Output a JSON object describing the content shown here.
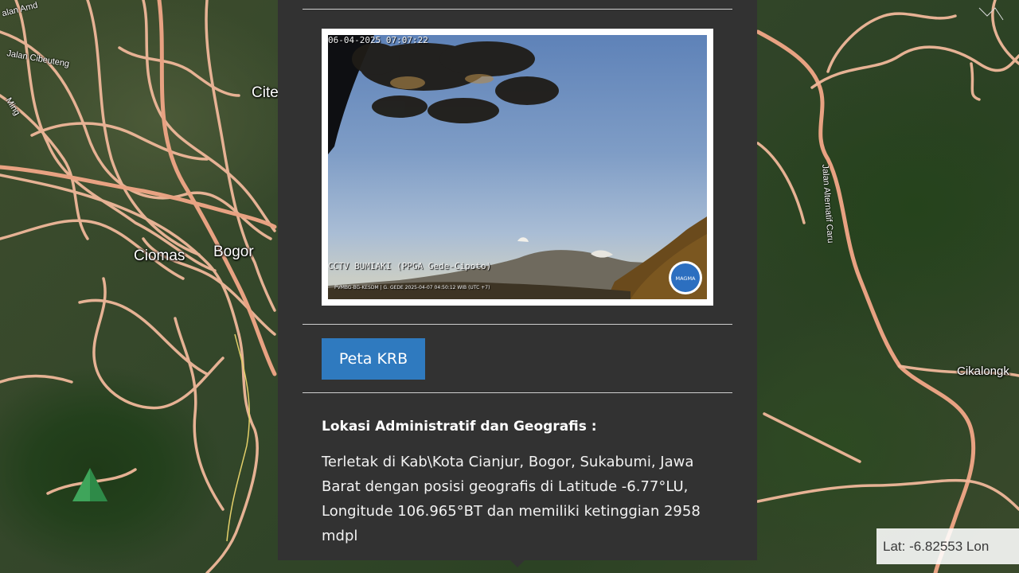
{
  "map": {
    "place_labels": {
      "ciomas": "Ciomas",
      "bogor": "Bogor",
      "cite": "Cite",
      "cikalong": "Cikalongk"
    },
    "road_labels": {
      "jalan_amd": "alan Amd",
      "jalan_cibeuteung": "Jalan Cibeuteng",
      "ming": "Ming",
      "jalan_aliexpresss": "Jalan Alternatif Caru"
    },
    "coordinates_readout": "Lat: -6.82553 Lon",
    "marker_icon": "green-triangle-volcano-icon",
    "colors": {
      "road": "#f0b89a",
      "road_major": "#e8a282"
    }
  },
  "popup": {
    "cctv": {
      "timestamp": "06-04-2025 07:07:22",
      "caption": "CCTV BUMIAKI (PPGA Gede-Cipoto)",
      "footer": "PVMBG-BG-KESDM | G. GEDE 2025-04-07 04:50:12 WIB (UTC +7)",
      "logo_text": "MAGMA",
      "logo_icon": "magma-logo-icon"
    },
    "krb_button_label": "Peta KRB",
    "section_heading": "Lokasi Administratif dan Geografis :",
    "section_body": "Terletak di Kab\\Kota Cianjur, Bogor, Sukabumi, Jawa Barat dengan posisi geografis di Latitude -6.77°LU, Longitude 106.965°BT dan memiliki ketinggian 2958 mdpl",
    "colors": {
      "background": "#323232",
      "button": "#2f7abf"
    }
  }
}
